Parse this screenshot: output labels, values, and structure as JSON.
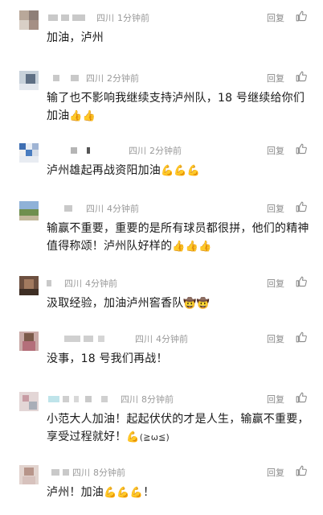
{
  "ui": {
    "reply_label": "回复",
    "like_icon": "thumb-up-outline-icon",
    "text_color": "#1a1a1a",
    "meta_color": "#9a9a9a"
  },
  "comments": [
    {
      "name_visible": "",
      "location": "四川",
      "time": "1分钟前",
      "text": "加油，泸州",
      "emoji": "",
      "suffix": ""
    },
    {
      "name_visible": "",
      "location": "四川",
      "time": "2分钟前",
      "text": "输了也不影响我继续支持泸州队，18 号继续给你们加油",
      "emoji": "👍👍",
      "suffix": ""
    },
    {
      "name_visible": "",
      "location": "四川",
      "time": "2分钟前",
      "text": "泸州雄起再战资阳加油",
      "emoji": "💪💪💪",
      "suffix": ""
    },
    {
      "name_visible": "",
      "location": "四川",
      "time": "4分钟前",
      "text": "输赢不重要，重要的是所有球员都很拼，他们的精神值得称颂！泸州队好样的",
      "emoji": "👍👍👍",
      "suffix": ""
    },
    {
      "name_visible": "",
      "location": "四川",
      "time": "4分钟前",
      "text": "汲取经验，加油泸州窖香队",
      "emoji": "🤠🤠",
      "suffix": ""
    },
    {
      "name_visible": "",
      "location": "四川",
      "time": "4分钟前",
      "text": "没事，18 号我们再战！",
      "emoji": "",
      "suffix": ""
    },
    {
      "name_visible": "",
      "location": "四川",
      "time": "8分钟前",
      "text": "小范大人加油！起起伏伏的才是人生，输赢不重要，享受过程就好！",
      "emoji": "💪",
      "suffix": "(≧ω≦)"
    },
    {
      "name_visible": "",
      "location": "四川",
      "time": "8分钟前",
      "text": "泸州！加油",
      "emoji": "💪💪💪",
      "suffix": "！"
    }
  ]
}
